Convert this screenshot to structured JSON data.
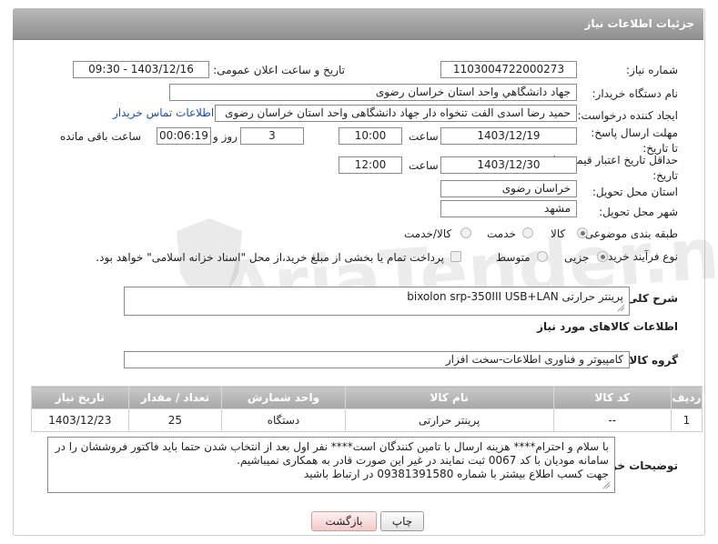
{
  "header": {
    "title": "جزئیات اطلاعات نیاز"
  },
  "fields": {
    "need_number_label": "شماره نیاز:",
    "need_number_value": "1103004722000273",
    "announce_label": "تاریخ و ساعت اعلان عمومی:",
    "announce_value": "1403/12/16 - 09:30",
    "buyer_label": "نام دستگاه خریدار:",
    "buyer_value": "جهاد دانشگاهي واحد استان خراسان رضوی",
    "requester_label": "ایجاد کننده درخواست:",
    "requester_value": "حمید رضا اسدی الفت تنخواه دار جهاد دانشگاهی واحد استان خراسان رضوی",
    "contact_link": "اطلاعات تماس خریدار",
    "deadline_label": "مهلت ارسال پاسخ: تا تاریخ:",
    "deadline_date": "1403/12/19",
    "time_label": "ساعت",
    "deadline_time": "10:00",
    "days_value": "3",
    "days_label": "روز و",
    "remaining_value": "00:06:19",
    "remaining_label": "ساعت باقی مانده",
    "validity_label": "حداقل تاریخ اعتبار قیمت: تا تاریخ:",
    "validity_date": "1403/12/30",
    "validity_time": "12:00",
    "province_label": "استان محل تحویل:",
    "province_value": "خراسان رضوی",
    "city_label": "شهر محل تحویل:",
    "city_value": "مشهد",
    "category_label": "طبقه بندی موضوعی:",
    "category_options": [
      "کالا",
      "خدمت",
      "کالا/خدمت"
    ],
    "process_label": "نوع فرآیند خرید :",
    "process_options": [
      "جزیی",
      "متوسط"
    ],
    "payment_note": "پرداخت تمام یا بخشی از مبلغ خرید،از محل \"اسناد خزانه اسلامی\" خواهد بود."
  },
  "description": {
    "label": "شرح کلی نیاز:",
    "value": "پرینتر حرارتی bixolon srp-350III USB+LAN"
  },
  "goods_section_title": "اطلاعات کالاهای مورد نیاز",
  "goods_group": {
    "label": "گروه کالا:",
    "value": "کامپیوتر و فناوری اطلاعات-سخت افزار"
  },
  "table": {
    "headers": [
      "ردیف",
      "کد کالا",
      "نام کالا",
      "واحد شمارش",
      "تعداد / مقدار",
      "تاریخ نیاز"
    ],
    "rows": [
      [
        "1",
        "--",
        "پرینتر حرارتی",
        "دستگاه",
        "25",
        "1403/12/23"
      ]
    ]
  },
  "buyer_notes": {
    "label": "توضیحات خریدار:",
    "lines": [
      "با سلام و احترام**** هزینه ارسال با تامین کنندگان است**** نفر اول بعد از انتخاب شدن حتما باید فاکتور فروششان را در",
      "سامانه مودیان با کد 0067 ثبت نمایند در غیر این صورت قادر به همکاری نمیباشیم.",
      "جهت کسب اطلاع بیشتر با شماره 09381391580 در ارتباط باشید"
    ]
  },
  "buttons": {
    "print": "چاپ",
    "back": "بازگشت"
  },
  "watermark": "AriaTender.neT"
}
